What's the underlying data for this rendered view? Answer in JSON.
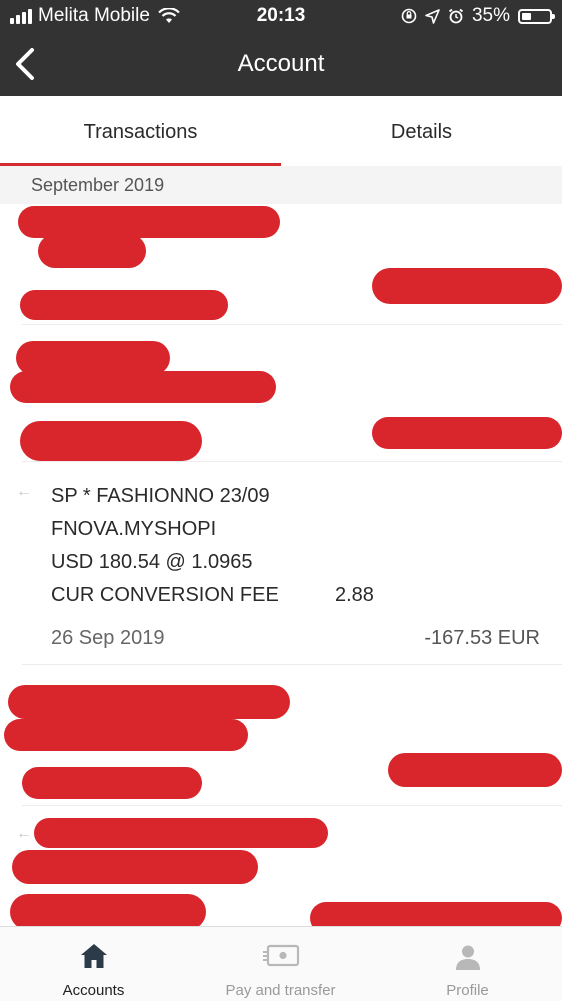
{
  "status": {
    "carrier": "Melita Mobile",
    "time": "20:13",
    "battery": "35%"
  },
  "nav": {
    "title": "Account"
  },
  "tabs": [
    {
      "label": "Transactions"
    },
    {
      "label": "Details"
    }
  ],
  "month_header": "September 2019",
  "transaction": {
    "line1": "SP * FASHIONNO 23/09",
    "line2": "FNOVA.MYSHOPI",
    "line3": "USD 180.54 @ 1.0965",
    "fee_label": "CUR CONVERSION FEE",
    "fee_value": "2.88",
    "date": "26 Sep 2019",
    "amount": "-167.53 EUR"
  },
  "tab_bar": [
    {
      "label": "Accounts",
      "icon": "home-icon"
    },
    {
      "label": "Pay and transfer",
      "icon": "money-transfer-icon"
    },
    {
      "label": "Profile",
      "icon": "profile-icon"
    }
  ],
  "colors": {
    "header_bg": "#333333",
    "accent": "#d52a2f",
    "redaction": "#d8262c"
  }
}
